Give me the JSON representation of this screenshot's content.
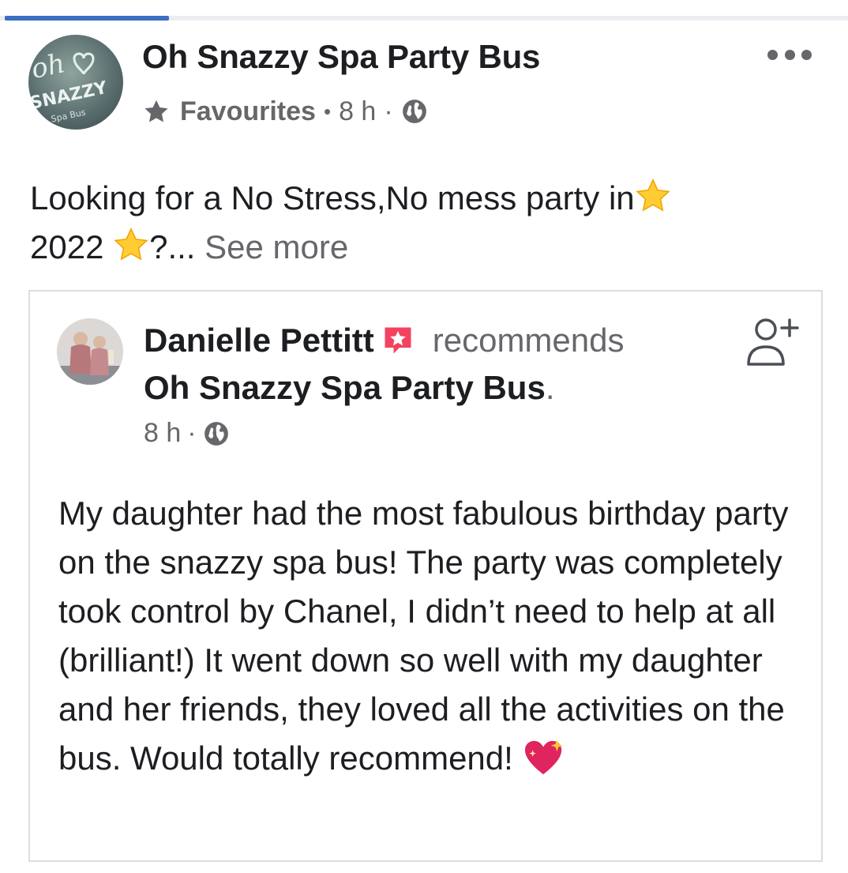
{
  "post": {
    "page_name": "Oh Snazzy Spa Party Bus",
    "avatar_text": "oh SNAZZY Spa Bus",
    "favourites_label": "Favourites",
    "bullet": "•",
    "time": "8 h",
    "separator": "·",
    "text_part1": "Looking for a No Stress,No mess party in",
    "text_part2": "2022 ",
    "text_part3": "?...",
    "see_more": " See more",
    "icons": [
      "star-icon",
      "globe-icon",
      "more-icon"
    ]
  },
  "recommendation": {
    "author": "Danielle Pettitt",
    "verb": "recommends",
    "page_name": "Oh Snazzy Spa Party Bus",
    "period": ".",
    "time": "8 h",
    "separator": "·",
    "review": "My daughter had the most fabulous birthday party on the snazzy spa bus! The party was completely took control by Chanel, I didn’t need to help at all (brilliant!) It went down so well with my daughter and her friends, they loved all the activities on the bus. Would totally recommend! ",
    "badge_color": "#f3425f",
    "icons": [
      "recommend-badge-icon",
      "globe-icon",
      "add-friend-icon",
      "sparkling-heart-icon"
    ]
  },
  "colors": {
    "text": "#1c1e21",
    "secondary": "#65676b",
    "border": "#dadde1",
    "progress": "#3b6fc1"
  }
}
